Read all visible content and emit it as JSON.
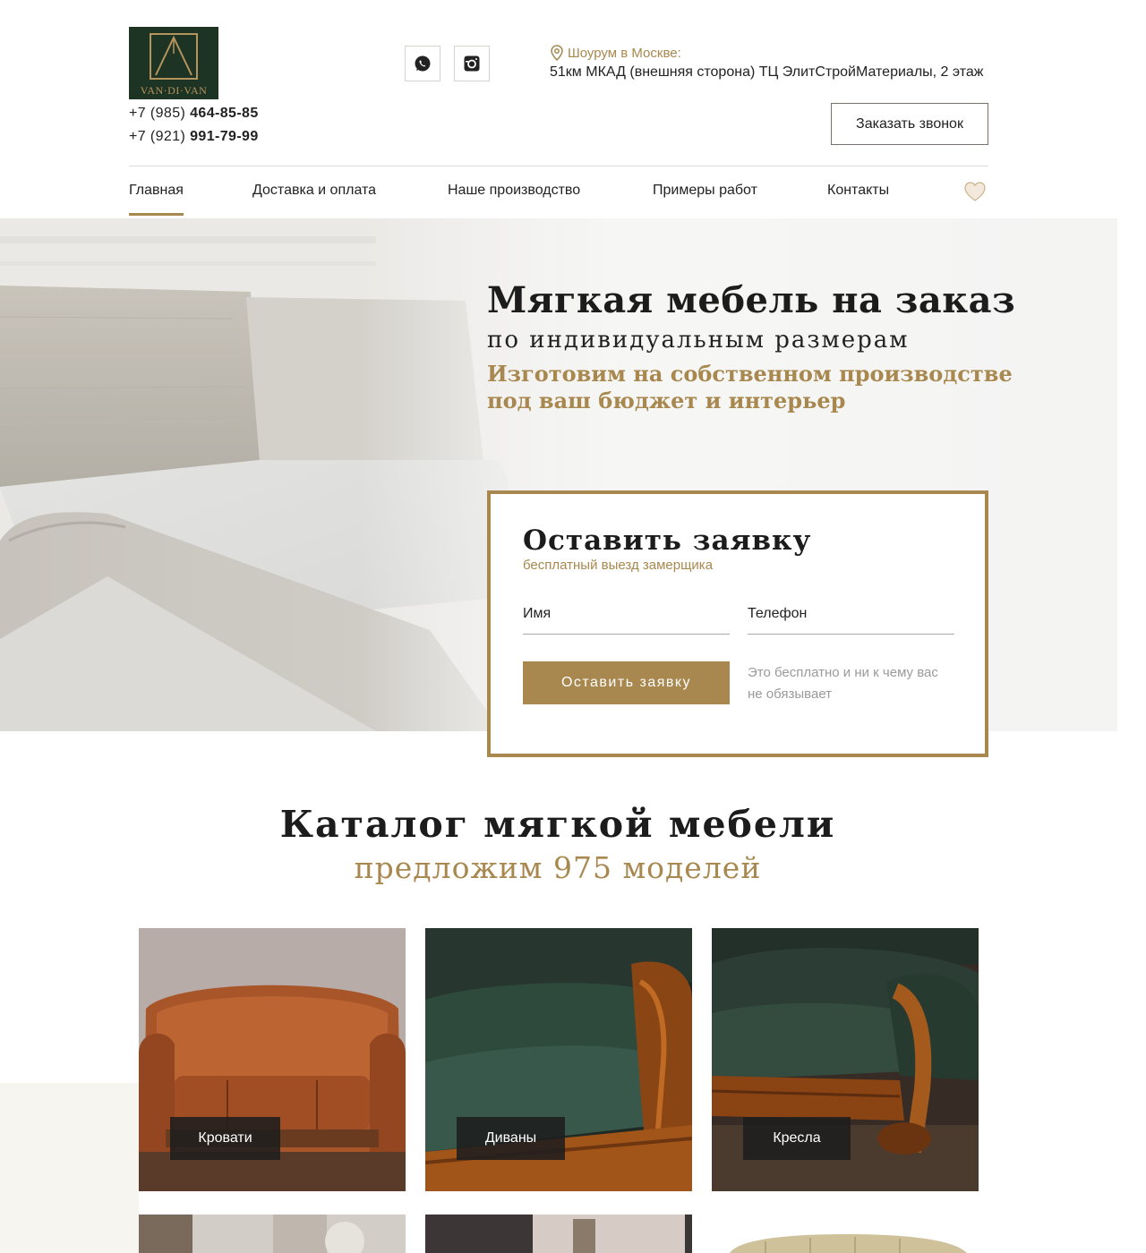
{
  "header": {
    "logo": {
      "text": "VAN·DI·VAN",
      "icon": "logo-icon"
    },
    "phones": [
      {
        "prefix": "+7 (985)",
        "number": "464-85-85"
      },
      {
        "prefix": "+7 (921)",
        "number": "991-79-99"
      }
    ],
    "social": [
      {
        "name": "whatsapp",
        "icon": "whatsapp-icon"
      },
      {
        "name": "instagram",
        "icon": "instagram-icon"
      }
    ],
    "address_label": "Шоурум в Москве:",
    "address_text": "51км МКАД (внешняя сторона) ТЦ ЭлитСтройМатериалы, 2 этаж",
    "callback_label": "Заказать звонок"
  },
  "nav": {
    "items": [
      {
        "label": "Главная",
        "active": true
      },
      {
        "label": "Доставка и оплата",
        "active": false
      },
      {
        "label": "Наше производство",
        "active": false
      },
      {
        "label": "Примеры работ",
        "active": false
      },
      {
        "label": "Контакты",
        "active": false
      }
    ],
    "favorites_icon": "heart-icon"
  },
  "hero": {
    "title": "Мягкая мебель на заказ",
    "subtitle": "по индивидуальным размерам",
    "tagline_1": "Изготовим на собственном производстве",
    "tagline_2": "под ваш бюджет и интерьер"
  },
  "form": {
    "title": "Оставить заявку",
    "subtitle": "бесплатный выезд замерщика",
    "name_placeholder": "Имя",
    "phone_placeholder": "Телефон",
    "submit_label": "Оставить заявку",
    "note": "Это бесплатно и ни к чему вас не обязывает"
  },
  "catalog": {
    "title": "Каталог мягкой мебели",
    "subtitle": "предложим 975 моделей",
    "cards": [
      {
        "label": "Кровати"
      },
      {
        "label": "Диваны"
      },
      {
        "label": "Кресла"
      }
    ]
  },
  "colors": {
    "accent": "#a8884f",
    "logo_bg": "#1d3324",
    "text": "#222222"
  }
}
